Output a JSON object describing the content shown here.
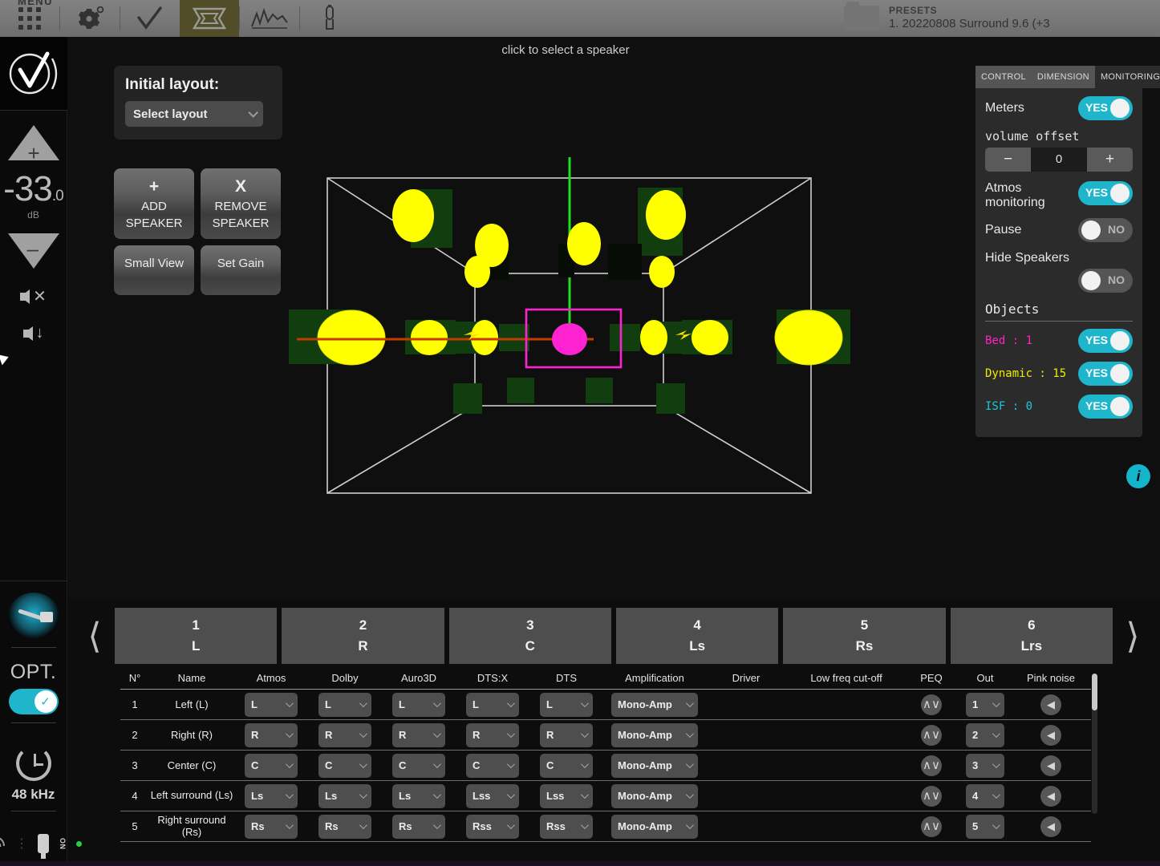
{
  "topbar": {
    "menu_label": "MENU",
    "icons": [
      "grid-menu-icon",
      "gear-settings-icon",
      "check-calibration-icon",
      "room-view-icon",
      "analyzer-icon",
      "mic-icon"
    ],
    "presets": {
      "title": "PRESETS",
      "value": "1. 20220808 Surround 9.6 (+3"
    }
  },
  "sidebar": {
    "volume": "-33",
    "volume_decimal": ".0",
    "volume_unit": "dB",
    "plus_label": "+",
    "minus_label": "−",
    "mute_icon": "speaker-mute-icon",
    "dim_icon": "speaker-dim-icon",
    "xlr_icon": "xlr-connector-icon",
    "opt_label": "OPT.",
    "opt_toggle": "on",
    "clock_icon": "sample-rate-clock-icon",
    "sample_rate": "48 kHz",
    "wifi_icon": "wifi-icon",
    "plug_icon": "power-plug-icon",
    "plug_state": "ON"
  },
  "stage": {
    "hint": "click to select a speaker",
    "layout_panel": {
      "title": "Initial layout:",
      "select_value": "Select layout"
    },
    "buttons": {
      "add_symbol": "+",
      "add_line1": "ADD",
      "add_line2": "SPEAKER",
      "remove_symbol": "X",
      "remove_line1": "REMOVE",
      "remove_line2": "SPEAKER",
      "small_view": "Small View",
      "set_gain": "Set Gain"
    },
    "info_icon": "info-icon"
  },
  "control_panel": {
    "tabs": [
      {
        "label": "CONTROL",
        "active": true
      },
      {
        "label": "DIMENSION",
        "active": true
      },
      {
        "label": "MONITORING",
        "active": false
      }
    ],
    "meters": {
      "label": "Meters",
      "value": "YES"
    },
    "volume_offset": {
      "label": "volume offset",
      "minus": "−",
      "value": "0",
      "plus": "+"
    },
    "atmos_monitoring": {
      "label_line1": "Atmos",
      "label_line2": "monitoring",
      "value": "YES"
    },
    "pause": {
      "label": "Pause",
      "value": "NO"
    },
    "hide_speakers": {
      "label": "Hide Speakers",
      "value": "NO"
    },
    "objects_title": "Objects",
    "objects": [
      {
        "label": "Bed : 1",
        "value": "YES",
        "color": "#ff22c8"
      },
      {
        "label": "Dynamic : 15",
        "value": "YES",
        "color": "#eeee00"
      },
      {
        "label": "ISF : 0",
        "value": "YES",
        "color": "#18c8d8"
      }
    ]
  },
  "speaker_tabs": {
    "prev": "‹",
    "next": "›",
    "items": [
      {
        "num": "1",
        "name": "L"
      },
      {
        "num": "2",
        "name": "R"
      },
      {
        "num": "3",
        "name": "C"
      },
      {
        "num": "4",
        "name": "Ls"
      },
      {
        "num": "5",
        "name": "Rs"
      },
      {
        "num": "6",
        "name": "Lrs"
      }
    ]
  },
  "table": {
    "headers": [
      "N°",
      "Name",
      "Atmos",
      "Dolby",
      "Auro3D",
      "DTS:X",
      "DTS",
      "Amplification",
      "Driver",
      "Low freq cut-off",
      "PEQ",
      "Out",
      "Pink noise"
    ],
    "rows": [
      {
        "n": "1",
        "name": "Left (L)",
        "atmos": "L",
        "dolby": "L",
        "auro3d": "L",
        "dtsx": "L",
        "dts": "L",
        "amplification": "Mono-Amp",
        "driver": "",
        "lowfreq": "",
        "peq": "peq-icon",
        "out": "1",
        "pink": "pink-noise-icon"
      },
      {
        "n": "2",
        "name": "Right (R)",
        "atmos": "R",
        "dolby": "R",
        "auro3d": "R",
        "dtsx": "R",
        "dts": "R",
        "amplification": "Mono-Amp",
        "driver": "",
        "lowfreq": "",
        "peq": "peq-icon",
        "out": "2",
        "pink": "pink-noise-icon"
      },
      {
        "n": "3",
        "name": "Center (C)",
        "atmos": "C",
        "dolby": "C",
        "auro3d": "C",
        "dtsx": "C",
        "dts": "C",
        "amplification": "Mono-Amp",
        "driver": "",
        "lowfreq": "",
        "peq": "peq-icon",
        "out": "3",
        "pink": "pink-noise-icon"
      },
      {
        "n": "4",
        "name": "Left surround (Ls)",
        "atmos": "Ls",
        "dolby": "Ls",
        "auro3d": "Ls",
        "dtsx": "Lss",
        "dts": "Lss",
        "amplification": "Mono-Amp",
        "driver": "",
        "lowfreq": "",
        "peq": "peq-icon",
        "out": "4",
        "pink": "pink-noise-icon"
      },
      {
        "n": "5",
        "name": "Right surround (Rs)",
        "atmos": "Rs",
        "dolby": "Rs",
        "auro3d": "Rs",
        "dtsx": "Rss",
        "dts": "Rss",
        "amplification": "Mono-Amp",
        "driver": "",
        "lowfreq": "",
        "peq": "peq-icon",
        "out": "5",
        "pink": "pink-noise-icon"
      }
    ]
  },
  "room_view": {
    "colors": {
      "speaker": "#ffff00",
      "object": "#ff22d0",
      "axis": "#22dd22",
      "wire": "#cfcfcf",
      "meter_bg": "#0b2a0b"
    },
    "selected_object_box": true
  }
}
